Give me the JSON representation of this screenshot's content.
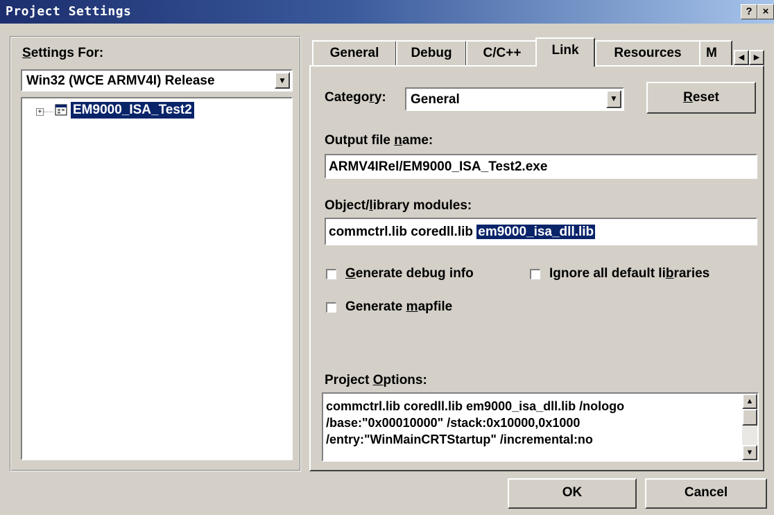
{
  "window": {
    "title": "Project Settings",
    "help_button": "?",
    "close_button": "×"
  },
  "left": {
    "settings_for_label_prefix": "S",
    "settings_for_label_rest": "ettings For:",
    "config_value": "Win32 (WCE ARMV4I) Release",
    "tree": {
      "expander": "+",
      "project_name": "EM9000_ISA_Test2"
    }
  },
  "tabs": [
    {
      "label": "General"
    },
    {
      "label": "Debug"
    },
    {
      "label": "C/C++"
    },
    {
      "label": "Link",
      "active": true
    },
    {
      "label": "Resources"
    },
    {
      "label": "M"
    }
  ],
  "link": {
    "category_label_a": "Catego",
    "category_label_u": "r",
    "category_label_b": "y:",
    "category_value": "General",
    "reset_label_u": "R",
    "reset_label_rest": "eset",
    "output_label_a": "Output file ",
    "output_label_u": "n",
    "output_label_b": "ame:",
    "output_value": "ARMV4IRel/EM9000_ISA_Test2.exe",
    "modules_label_a": "Object/",
    "modules_label_u": "l",
    "modules_label_b": "ibrary modules:",
    "modules_value_plain": "commctrl.lib coredll.lib ",
    "modules_value_selected": "em9000_isa_dll.lib",
    "generate_debug_u": "G",
    "generate_debug_rest": "enerate debug info",
    "ignore_libs_a": "Ignore all default li",
    "ignore_libs_u": "b",
    "ignore_libs_b": "raries",
    "generate_map_a": "Generate ",
    "generate_map_u": "m",
    "generate_map_b": "apfile",
    "project_options_a": "Project ",
    "project_options_u": "O",
    "project_options_b": "ptions:",
    "project_options_text": "commctrl.lib coredll.lib em9000_isa_dll.lib /nologo\n/base:\"0x00010000\" /stack:0x10000,0x1000\n/entry:\"WinMainCRTStartup\" /incremental:no"
  },
  "buttons": {
    "ok": "OK",
    "cancel": "Cancel"
  },
  "colors": {
    "face": "#d4d0c8",
    "selection": "#0a246a",
    "title_start": "#1c2e6e",
    "title_end": "#a6c4ea"
  }
}
